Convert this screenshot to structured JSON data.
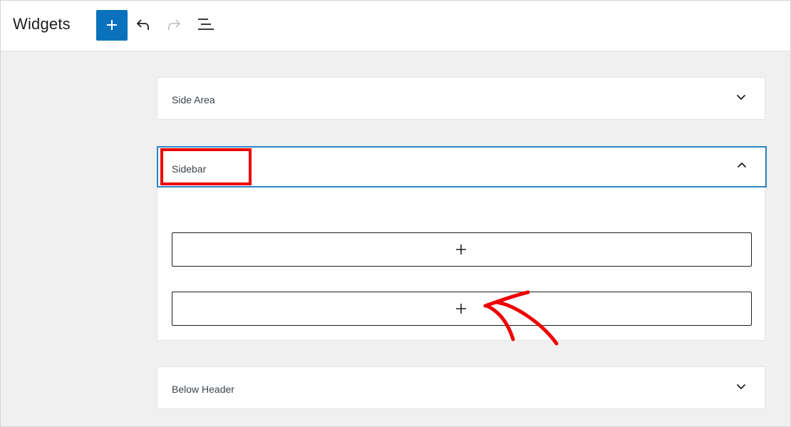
{
  "header": {
    "title": "Widgets",
    "icons": {
      "inserter": "plus-icon",
      "undo": "undo-icon",
      "redo": "redo-icon",
      "outline": "list-view-icon"
    }
  },
  "widget_areas": [
    {
      "title": "Side Area",
      "expanded": false,
      "chevron": "chevron-down-icon"
    },
    {
      "title": "Sidebar",
      "expanded": true,
      "chevron": "chevron-up-icon",
      "highlighted": true,
      "block_appenders": 2
    },
    {
      "title": "Below Header",
      "expanded": false,
      "chevron": "chevron-down-icon"
    }
  ],
  "colors": {
    "accent": "#0a72bd",
    "focus_border": "#2d84c6",
    "annotation": "#ee0000",
    "background": "#f0f0f1"
  }
}
